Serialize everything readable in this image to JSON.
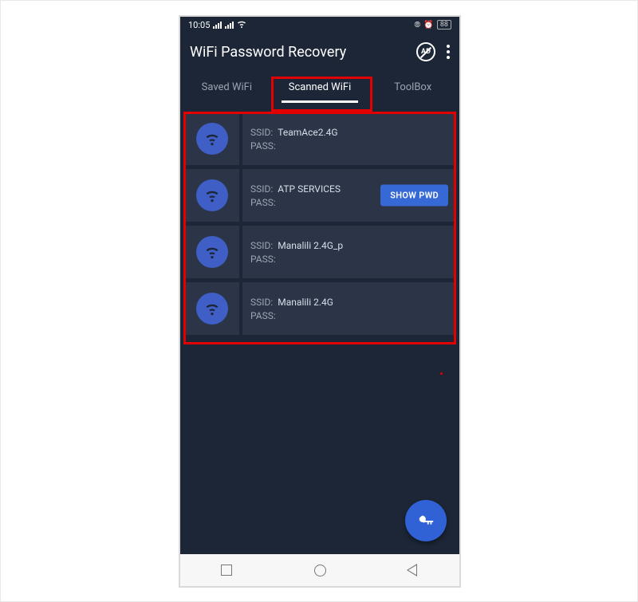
{
  "status": {
    "time": "10:05",
    "battery": "88"
  },
  "app": {
    "title": "WiFi Password Recovery"
  },
  "tabs": [
    {
      "label": "Saved WiFi",
      "active": false
    },
    {
      "label": "Scanned WiFi",
      "active": true
    },
    {
      "label": "ToolBox",
      "active": false
    }
  ],
  "labels": {
    "ssid": "SSID:",
    "pass": "PASS:",
    "show_pwd": "SHOW PWD"
  },
  "networks": [
    {
      "ssid": "TeamAce2.4G",
      "pass": "",
      "show_btn": false
    },
    {
      "ssid": "ATP SERVICES",
      "pass": "",
      "show_btn": true
    },
    {
      "ssid": "Manalili 2.4G_p",
      "pass": "",
      "show_btn": false
    },
    {
      "ssid": "Manalili 2.4G",
      "pass": "",
      "show_btn": false
    }
  ]
}
